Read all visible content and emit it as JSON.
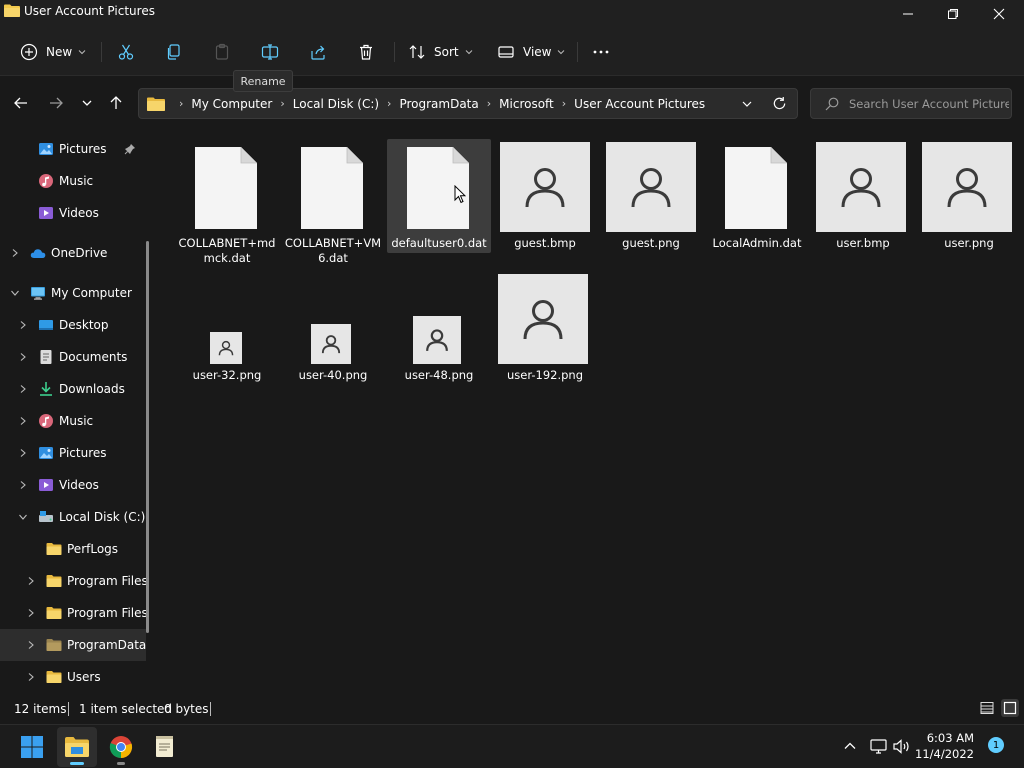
{
  "window": {
    "title": "User Account Pictures"
  },
  "toolbar": {
    "new_label": "New",
    "sort_label": "Sort",
    "view_label": "View",
    "tooltip": "Rename"
  },
  "address": {
    "crumbs": [
      "My Computer",
      "Local Disk (C:)",
      "ProgramData",
      "Microsoft",
      "User Account Pictures"
    ]
  },
  "search": {
    "placeholder": "Search User Account Pictures"
  },
  "sidebar": {
    "items": [
      {
        "label": "Pictures",
        "icon": "pictures-icon",
        "pinned": true
      },
      {
        "label": "Music",
        "icon": "music-icon"
      },
      {
        "label": "Videos",
        "icon": "videos-icon"
      },
      {
        "label": "OneDrive",
        "icon": "cloud-icon"
      },
      {
        "label": "My Computer",
        "icon": "computer-icon"
      },
      {
        "label": "Desktop",
        "icon": "desktop-icon"
      },
      {
        "label": "Documents",
        "icon": "documents-icon"
      },
      {
        "label": "Downloads",
        "icon": "download-icon"
      },
      {
        "label": "Music",
        "icon": "music-icon"
      },
      {
        "label": "Pictures",
        "icon": "pictures-icon"
      },
      {
        "label": "Videos",
        "icon": "videos-icon"
      },
      {
        "label": "Local Disk (C:)",
        "icon": "drive-icon"
      },
      {
        "label": "PerfLogs",
        "icon": "folder-icon"
      },
      {
        "label": "Program Files",
        "icon": "folder-icon"
      },
      {
        "label": "Program Files",
        "icon": "folder-icon"
      },
      {
        "label": "ProgramData",
        "icon": "folder-icon",
        "selected": true
      },
      {
        "label": "Users",
        "icon": "folder-icon"
      }
    ]
  },
  "files": [
    {
      "name": "COLLABNET+mdmck.dat",
      "kind": "document"
    },
    {
      "name": "COLLABNET+VM6.dat",
      "kind": "document"
    },
    {
      "name": "defaultuser0.dat",
      "kind": "document",
      "selected": true
    },
    {
      "name": "guest.bmp",
      "kind": "user-image"
    },
    {
      "name": "guest.png",
      "kind": "user-image"
    },
    {
      "name": "LocalAdmin.dat",
      "kind": "document"
    },
    {
      "name": "user.bmp",
      "kind": "user-image"
    },
    {
      "name": "user.png",
      "kind": "user-image"
    },
    {
      "name": "user-32.png",
      "kind": "user-image"
    },
    {
      "name": "user-40.png",
      "kind": "user-image"
    },
    {
      "name": "user-48.png",
      "kind": "user-image"
    },
    {
      "name": "user-192.png",
      "kind": "user-image"
    }
  ],
  "status": {
    "item_count": "12 items",
    "selection": "1 item selected",
    "size": "0 bytes"
  },
  "taskbar": {
    "time": "6:03 AM",
    "date": "11/4/2022",
    "notifications": "1"
  },
  "colors": {
    "accent": "#60cdff",
    "folder": "#f2c94c",
    "background": "#191919"
  }
}
